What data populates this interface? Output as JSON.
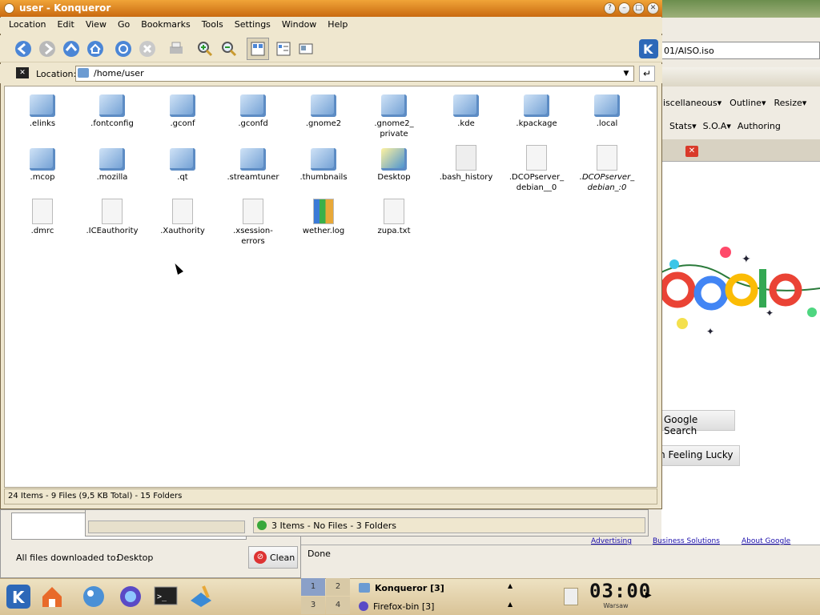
{
  "firefox": {
    "url_partial": "01/AISO.iso",
    "toolbar_items": [
      "iscellaneous▾",
      "Outline▾",
      "Resize▾"
    ],
    "toolbar2_items": [
      "Stats▾",
      "S.O.A▾",
      "Authoring"
    ],
    "google_search": "Google Search",
    "feeling_lucky": "m Feeling Lucky",
    "links": [
      "Advertising",
      "Business Solutions",
      "About Google"
    ],
    "status": "Done"
  },
  "downloads": {
    "label": "All files downloaded to:",
    "folder": "Desktop",
    "clean_button": "Clean",
    "status": "3 Items - No Files - 3 Folders"
  },
  "konqueror": {
    "title": "user - Konqueror",
    "menu": [
      "Location",
      "Edit",
      "View",
      "Go",
      "Bookmarks",
      "Tools",
      "Settings",
      "Window",
      "Help"
    ],
    "location_label": "Location:",
    "location_value": "/home/user",
    "items": [
      {
        "name": ".elinks",
        "type": "folder"
      },
      {
        "name": ".fontconfig",
        "type": "folder"
      },
      {
        "name": ".gconf",
        "type": "folder"
      },
      {
        "name": ".gconfd",
        "type": "folder"
      },
      {
        "name": ".gnome2",
        "type": "folder"
      },
      {
        "name": ".gnome2_\nprivate",
        "type": "folder"
      },
      {
        "name": ".kde",
        "type": "folder"
      },
      {
        "name": ".kpackage",
        "type": "folder"
      },
      {
        "name": ".local",
        "type": "folder"
      },
      {
        "name": ".mcop",
        "type": "folder"
      },
      {
        "name": ".mozilla",
        "type": "folder"
      },
      {
        "name": ".qt",
        "type": "folder"
      },
      {
        "name": ".streamtuner",
        "type": "folder"
      },
      {
        "name": ".thumbnails",
        "type": "folder"
      },
      {
        "name": "Desktop",
        "type": "desktop"
      },
      {
        "name": ".bash_history",
        "type": "locked"
      },
      {
        "name": ".DCOPserver_\ndebian__0",
        "type": "text"
      },
      {
        "name": ".DCOPserver_\ndebian_:0",
        "type": "text"
      },
      {
        "name": ".dmrc",
        "type": "text"
      },
      {
        "name": ".ICEauthority",
        "type": "blank"
      },
      {
        "name": ".Xauthority",
        "type": "blank"
      },
      {
        "name": ".xsession-\nerrors",
        "type": "text"
      },
      {
        "name": "wether.log",
        "type": "chart"
      },
      {
        "name": "zupa.txt",
        "type": "text"
      }
    ],
    "status": "24 Items - 9 Files (9,5 KB Total) - 15 Folders"
  },
  "taskbar": {
    "pager": [
      "1",
      "2",
      "3",
      "4"
    ],
    "tasks": [
      "Konqueror [3]",
      "Firefox-bin [3]"
    ],
    "clock_time": "03:00",
    "clock_city": "Warsaw"
  }
}
